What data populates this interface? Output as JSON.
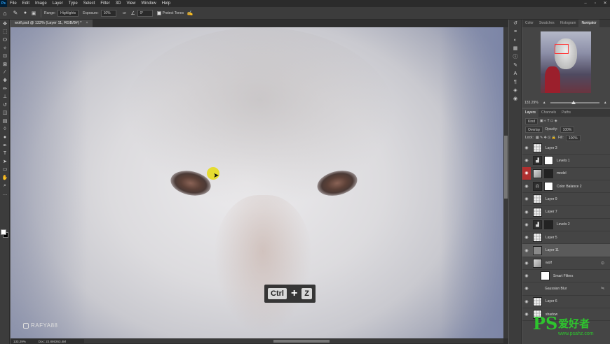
{
  "app": {
    "logo": "Ps"
  },
  "menu": [
    "File",
    "Edit",
    "Image",
    "Layer",
    "Type",
    "Select",
    "Filter",
    "3D",
    "View",
    "Window",
    "Help"
  ],
  "window_controls": [
    "–",
    "▫",
    "✕"
  ],
  "options": {
    "range_label": "Range:",
    "range_value": "Highlights",
    "exposure_label": "Exposure:",
    "exposure_value": "10%",
    "angle_value": "0°",
    "protect_tones_label": "Protect Tones"
  },
  "document": {
    "tab_title": "wolf.psd @ 133% (Layer 11, RGB/8#) *",
    "close": "×"
  },
  "canvas": {
    "watermark_handle": "RAFYA88",
    "keys": {
      "key1": "Ctrl",
      "plus": "+",
      "key2": "Z"
    }
  },
  "status": {
    "zoom": "133.29%",
    "doc": "Doc: 22.8M/263.4M"
  },
  "navigator": {
    "tabs": [
      "Color",
      "Swatches",
      "Histogram",
      "Navigator"
    ],
    "active_tab": "Navigator",
    "zoom": "133.29%"
  },
  "layers_panel": {
    "tabs": [
      "Layers",
      "Channels",
      "Paths"
    ],
    "filter_kind": "Kind",
    "blend_mode": "Overlay",
    "opacity_label": "Opacity:",
    "opacity_value": "100%",
    "lock_label": "Lock:",
    "fill_label": "Fill:",
    "fill_value": "100%",
    "layers": [
      {
        "name": "Layer 3",
        "type": "pixel"
      },
      {
        "name": "Levels 1",
        "type": "adjustment"
      },
      {
        "name": "model",
        "type": "photo"
      },
      {
        "name": "Color Balance 2",
        "type": "adjustment"
      },
      {
        "name": "Layer 9",
        "type": "pixel"
      },
      {
        "name": "Layer 7",
        "type": "pixel"
      },
      {
        "name": "Levels 2",
        "type": "adjustment"
      },
      {
        "name": "Layer 5",
        "type": "pixel"
      },
      {
        "name": "Layer 11",
        "type": "pixel"
      },
      {
        "name": "wolf",
        "type": "smart"
      },
      {
        "name": "Smart Filters",
        "type": "filter"
      },
      {
        "name": "Gaussian Blur",
        "type": "filter"
      },
      {
        "name": "Layer 6",
        "type": "pixel"
      },
      {
        "name": "shadow",
        "type": "pixel"
      }
    ]
  },
  "site_watermark": {
    "ps": "PS",
    "cn": "爱好者",
    "url": "www.psahz.com"
  },
  "colors": {
    "accent_red": "#b03030",
    "highlight_cursor": "#e6dc1e",
    "watermark_green": "#2ec52e"
  }
}
